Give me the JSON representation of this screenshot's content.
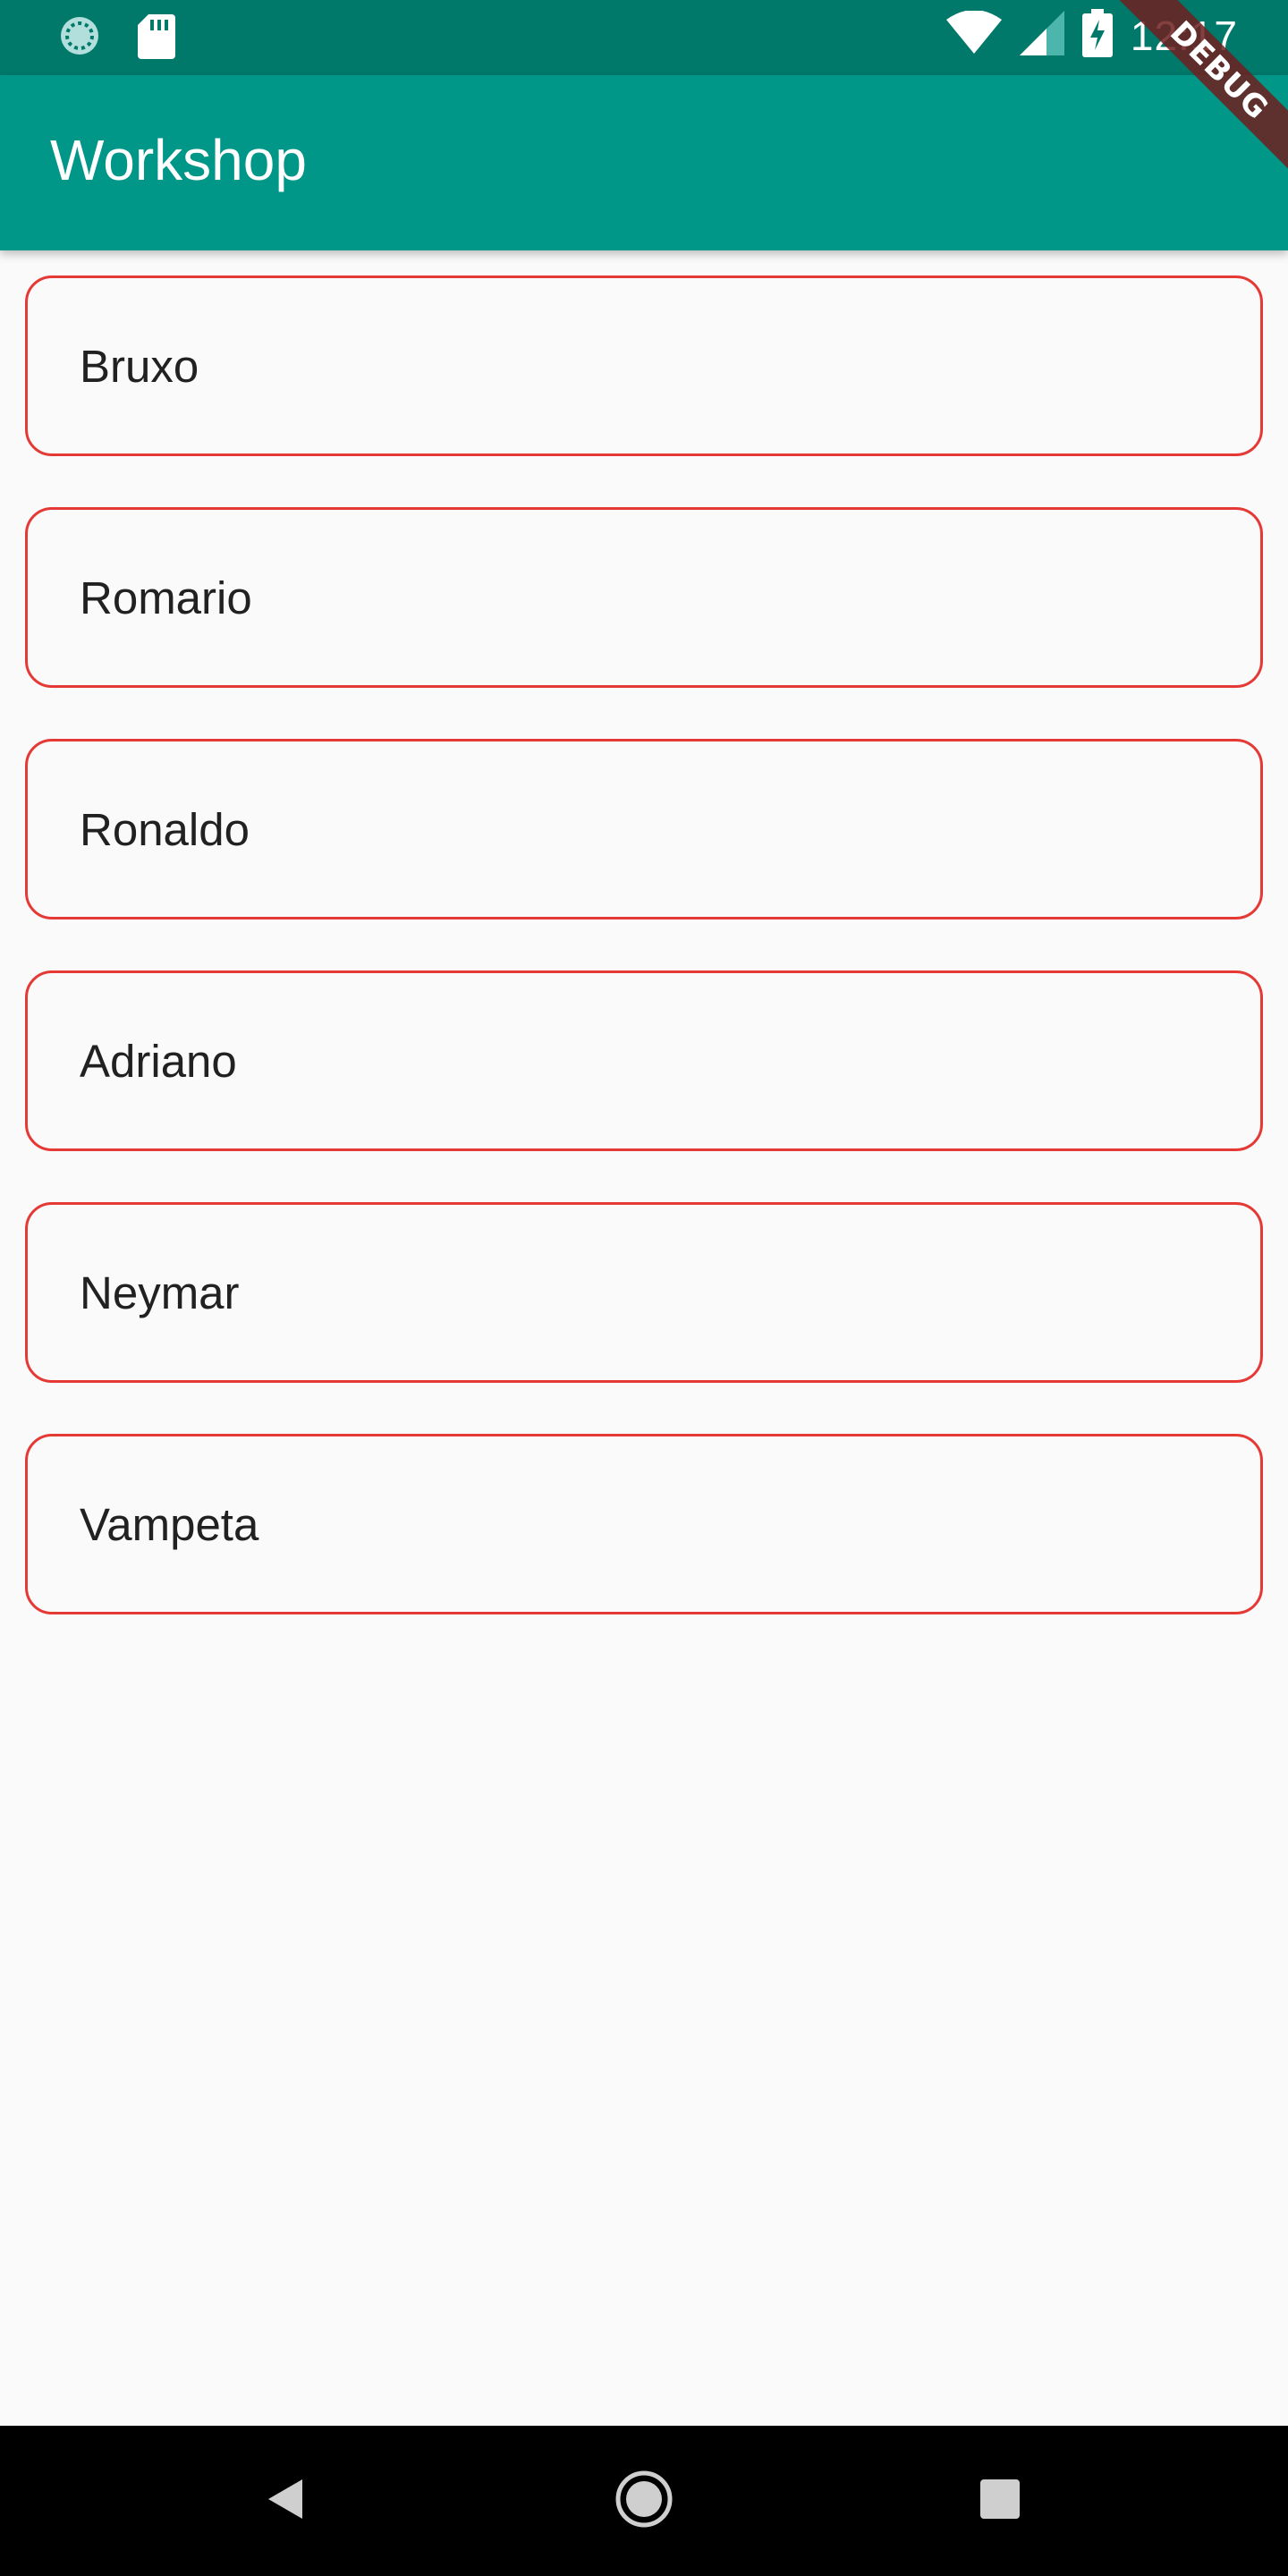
{
  "status_bar": {
    "time": "12:17",
    "icons": [
      "sync-icon",
      "sd-card-icon",
      "wifi-icon",
      "signal-icon",
      "battery-charging-icon"
    ]
  },
  "app_bar": {
    "title": "Workshop"
  },
  "debug_banner": {
    "label": "DEBUG"
  },
  "list": {
    "items": [
      {
        "label": "Bruxo"
      },
      {
        "label": "Romario"
      },
      {
        "label": "Ronaldo"
      },
      {
        "label": "Adriano"
      },
      {
        "label": "Neymar"
      },
      {
        "label": "Vampeta"
      }
    ]
  },
  "nav_bar": {
    "icons": [
      "back-icon",
      "home-icon",
      "recents-icon"
    ]
  },
  "colors": {
    "status_bar": "#00796b",
    "app_bar": "#009688",
    "card_border": "#e53935",
    "background": "#fafafa"
  }
}
